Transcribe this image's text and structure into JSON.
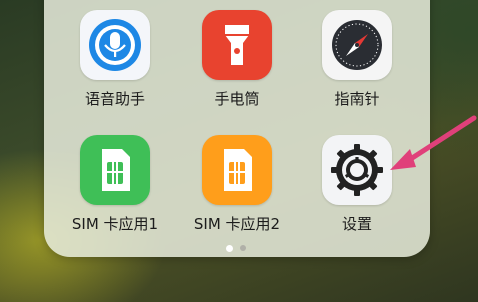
{
  "folder": {
    "apps": [
      {
        "label": "语音助手",
        "icon": "microphone-icon",
        "color": "#1E88E5"
      },
      {
        "label": "手电筒",
        "icon": "flashlight-icon",
        "color": "#E53935"
      },
      {
        "label": "指南针",
        "icon": "compass-icon",
        "color": "#2B2B2B"
      },
      {
        "label": "SIM 卡应用1",
        "icon": "sim-card-icon",
        "color": "#3FBF57"
      },
      {
        "label": "SIM 卡应用2",
        "icon": "sim-card-icon",
        "color": "#FF9E1B"
      },
      {
        "label": "设置",
        "icon": "gear-icon",
        "color": "#222222"
      }
    ],
    "pages": {
      "count": 2,
      "active": 1
    }
  },
  "annotation": {
    "arrow_color": "#E0407A",
    "target": "设置"
  }
}
